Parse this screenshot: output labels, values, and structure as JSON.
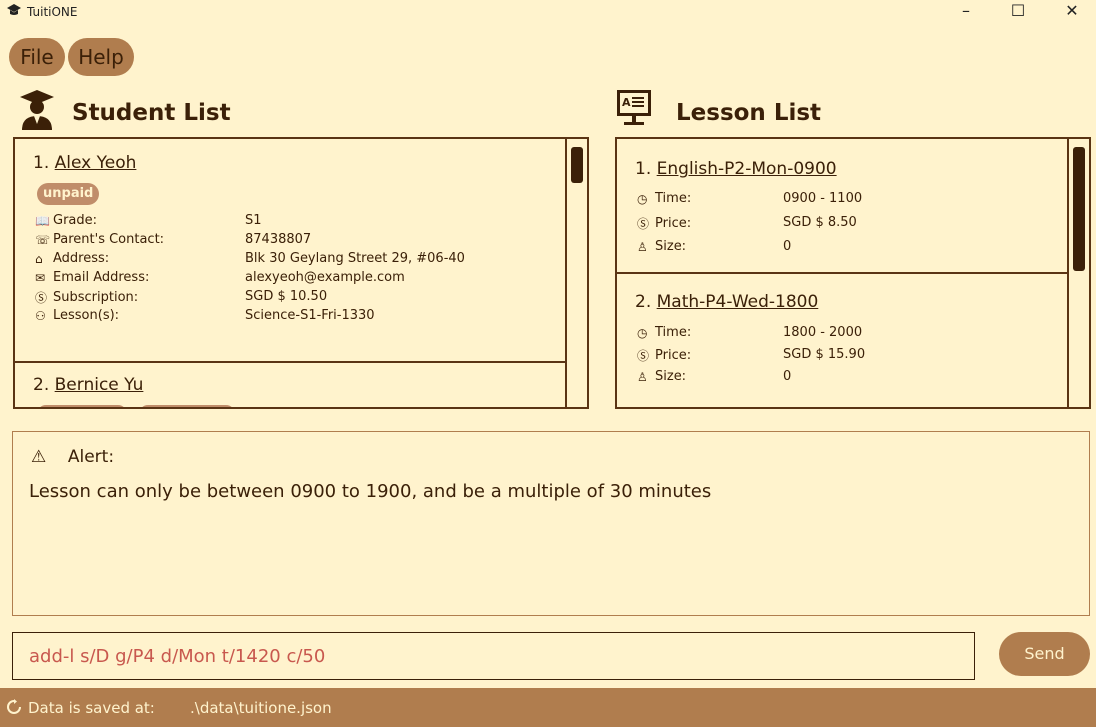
{
  "window": {
    "title": "TuitiONE",
    "minimize": "–",
    "maximize": "☐",
    "close": "✕"
  },
  "menu": {
    "file": "File",
    "help": "Help"
  },
  "students": {
    "title": "Student List",
    "items": [
      {
        "index": "1.",
        "name": "Alex Yeoh",
        "tag": "unpaid",
        "fields": [
          {
            "icon": "book-icon",
            "glyph": "📖",
            "label": "Grade:",
            "value": "S1"
          },
          {
            "icon": "phone-icon",
            "glyph": "☏",
            "label": "Parent's Contact:",
            "value": "87438807"
          },
          {
            "icon": "home-icon",
            "glyph": "⌂",
            "label": "Address:",
            "value": "Blk 30 Geylang Street 29, #06-40"
          },
          {
            "icon": "mail-icon",
            "glyph": "✉",
            "label": "Email Address:",
            "value": "alexyeoh@example.com"
          },
          {
            "icon": "dollar-icon",
            "glyph": "Ⓢ",
            "label": "Subscription:",
            "value": "SGD $ 10.50"
          },
          {
            "icon": "lesson-icon",
            "glyph": "⚇",
            "label": "Lesson(s):",
            "value": "Science-S1-Fri-1330"
          }
        ]
      },
      {
        "index": "2.",
        "name": "Bernice Yu"
      }
    ]
  },
  "lessons": {
    "title": "Lesson List",
    "items": [
      {
        "index": "1.",
        "name": "English-P2-Mon-0900",
        "fields": [
          {
            "icon": "clock-icon",
            "glyph": "◷",
            "label": "Time:",
            "value": "0900 - 1100"
          },
          {
            "icon": "dollar-icon",
            "glyph": "Ⓢ",
            "label": "Price:",
            "value": "SGD $ 8.50"
          },
          {
            "icon": "person-icon",
            "glyph": "♙",
            "label": "Size:",
            "value": "0"
          }
        ]
      },
      {
        "index": "2.",
        "name": "Math-P4-Wed-1800",
        "fields": [
          {
            "icon": "clock-icon",
            "glyph": "◷",
            "label": "Time:",
            "value": "1800 - 2000"
          },
          {
            "icon": "dollar-icon",
            "glyph": "Ⓢ",
            "label": "Price:",
            "value": "SGD $ 15.90"
          },
          {
            "icon": "person-icon",
            "glyph": "♙",
            "label": "Size:",
            "value": "0"
          }
        ]
      }
    ]
  },
  "alert": {
    "icon": "⚠",
    "title": "Alert:",
    "message": "Lesson can only be between 0900 to 1900, and be a multiple of 30 minutes"
  },
  "command": {
    "value": "add-l s/D g/P4 d/Mon t/1420 c/50",
    "send_label": "Send"
  },
  "status": {
    "label": "Data is saved at:",
    "path": ".\\data\\tuitione.json"
  },
  "colors": {
    "background": "#fff3cd",
    "accent": "#b07d4e",
    "text": "#3b2008",
    "command_text": "#c8584e"
  }
}
